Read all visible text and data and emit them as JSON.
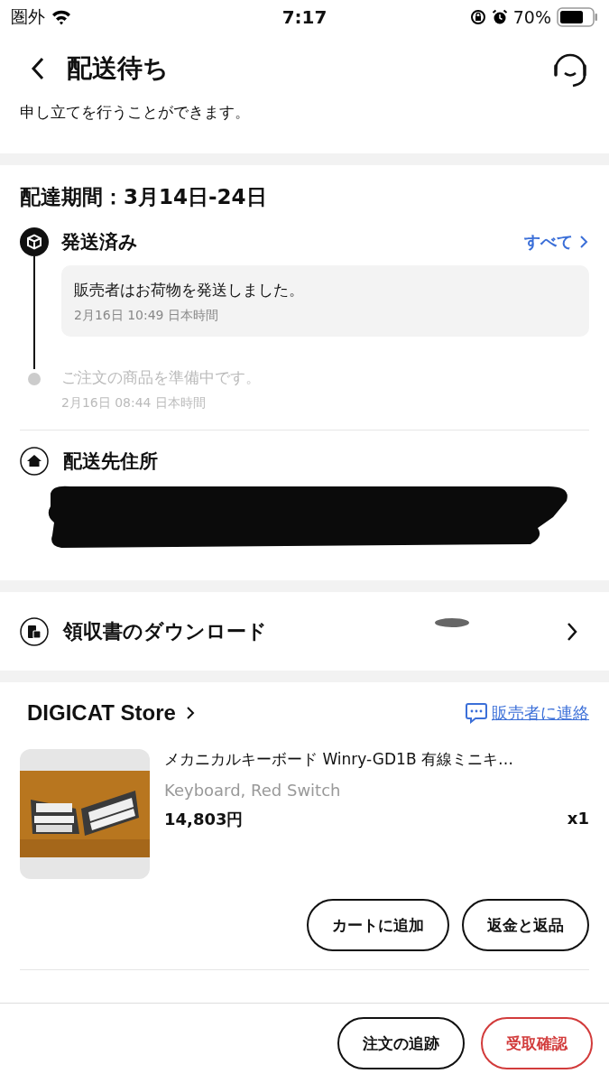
{
  "status_bar": {
    "carrier": "圏外",
    "time": "7:17",
    "battery": "70%"
  },
  "header": {
    "title": "配送待ち"
  },
  "cut_notice": "申し立てを行うことができます。",
  "delivery": {
    "period": "配達期間：3月14日-24日",
    "see_all": "すべて",
    "events": [
      {
        "title": "発送済み",
        "message": "販売者はお荷物を発送しました。",
        "time": "2月16日 10:49 日本時間",
        "active": true
      },
      {
        "message": "ご注文の商品を準備中です。",
        "time": "2月16日 08:44 日本時間",
        "active": false
      }
    ]
  },
  "address": {
    "title": "配送先住所"
  },
  "receipt": {
    "label": "領収書のダウンロード"
  },
  "store": {
    "name": "DIGICAT Store",
    "contact": "販売者に連絡",
    "item": {
      "title": "メカニカルキーボード Winry-GD1B 有線ミニキ…",
      "variant": "Keyboard, Red Switch",
      "price": "14,803円",
      "quantity": "x1"
    },
    "buttons": [
      "カートに追加",
      "返金と返品"
    ]
  },
  "footer_buttons": [
    {
      "label": "注文の追跡",
      "kind": "outline"
    },
    {
      "label": "受取確認",
      "kind": "primary"
    }
  ]
}
